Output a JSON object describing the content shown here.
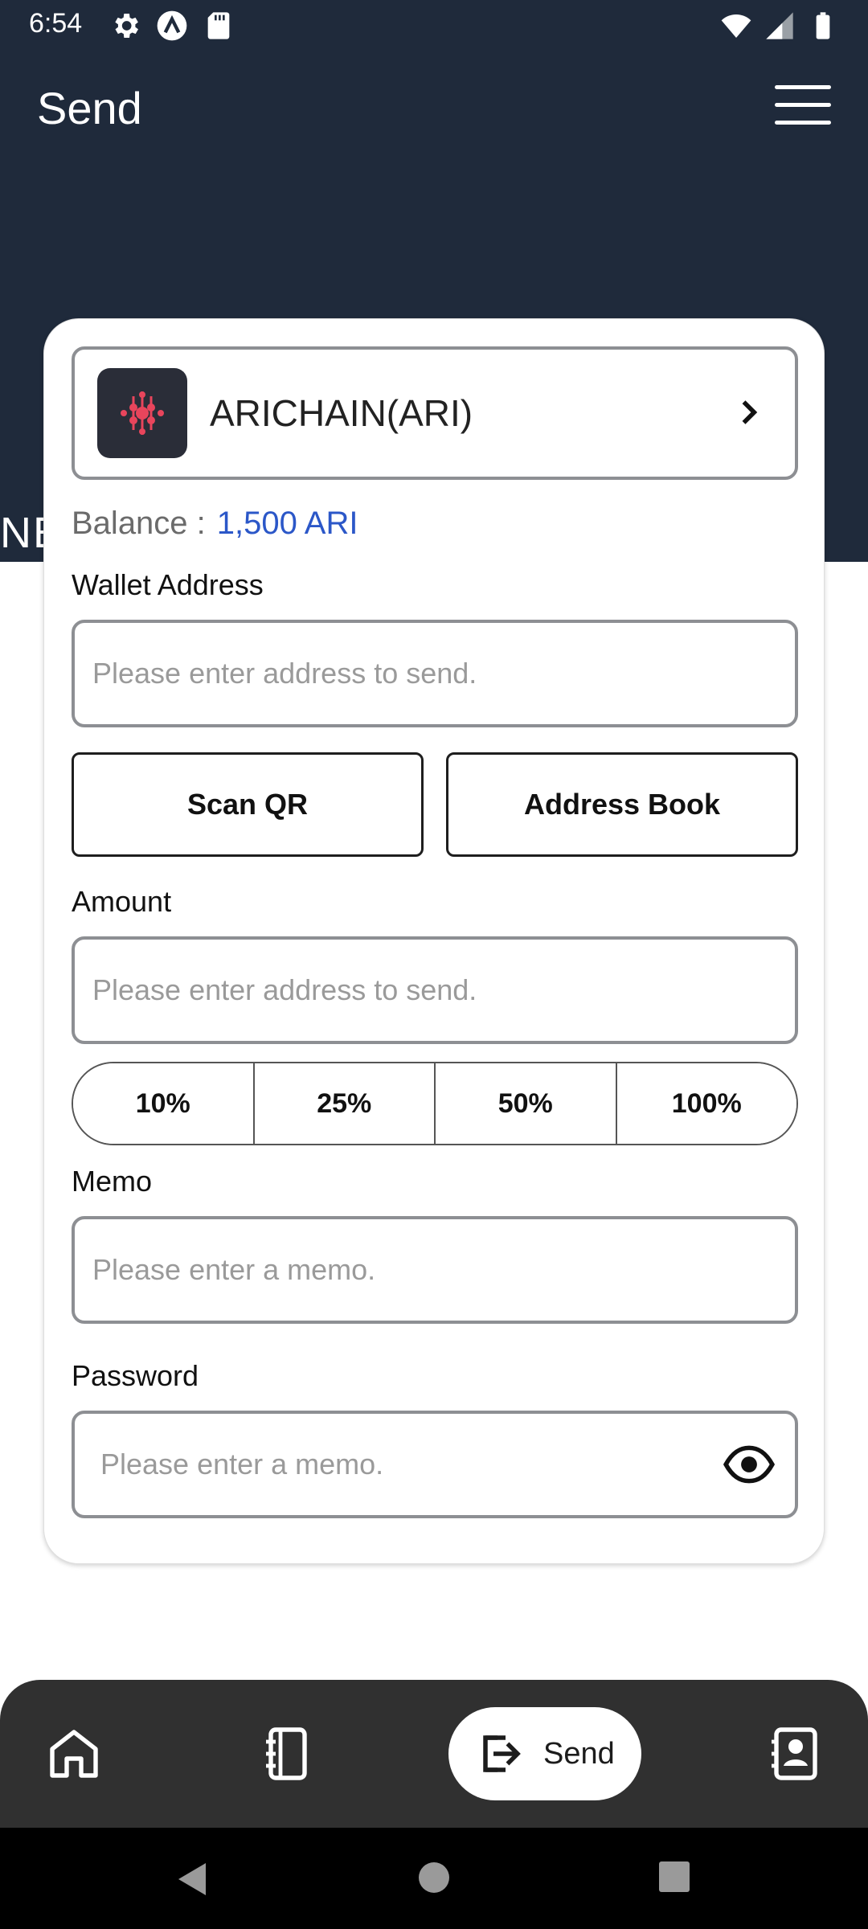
{
  "status_bar": {
    "time": "6:54",
    "left_icons": [
      "settings-gear-icon",
      "app-a-icon",
      "sd-card-icon"
    ],
    "right_icons": [
      "wifi-icon",
      "signal-icon",
      "battery-icon"
    ]
  },
  "header": {
    "title": "Send",
    "menu_icon": "hamburger-menu-icon",
    "background_partial_text": "NE"
  },
  "coin": {
    "name": "ARICHAIN(ARI)",
    "logo_icon": "arichain-logo-icon"
  },
  "balance": {
    "label": "Balance :",
    "value": "1,500 ARI"
  },
  "wallet_address": {
    "label": "Wallet Address",
    "value": "",
    "placeholder": "Please enter address to send."
  },
  "address_buttons": {
    "scan_qr": "Scan QR",
    "address_book": "Address Book"
  },
  "amount": {
    "label": "Amount",
    "value": "",
    "placeholder": "Please enter address to send.",
    "percent_options": [
      "10%",
      "25%",
      "50%",
      "100%"
    ]
  },
  "memo": {
    "label": "Memo",
    "value": "",
    "placeholder": "Please enter a memo."
  },
  "password": {
    "label": "Password",
    "value": "",
    "placeholder": "Please enter a memo.",
    "toggle_icon": "eye-icon"
  },
  "bottom_nav": {
    "items": [
      {
        "icon": "home-icon"
      },
      {
        "icon": "notebook-icon"
      },
      {
        "icon": "send-icon",
        "label": "Send",
        "active": true
      },
      {
        "icon": "contacts-icon"
      }
    ]
  },
  "colors": {
    "header_bg": "#1f2a3b",
    "balance_value": "#2b57c8",
    "nav_bg": "#303030"
  }
}
